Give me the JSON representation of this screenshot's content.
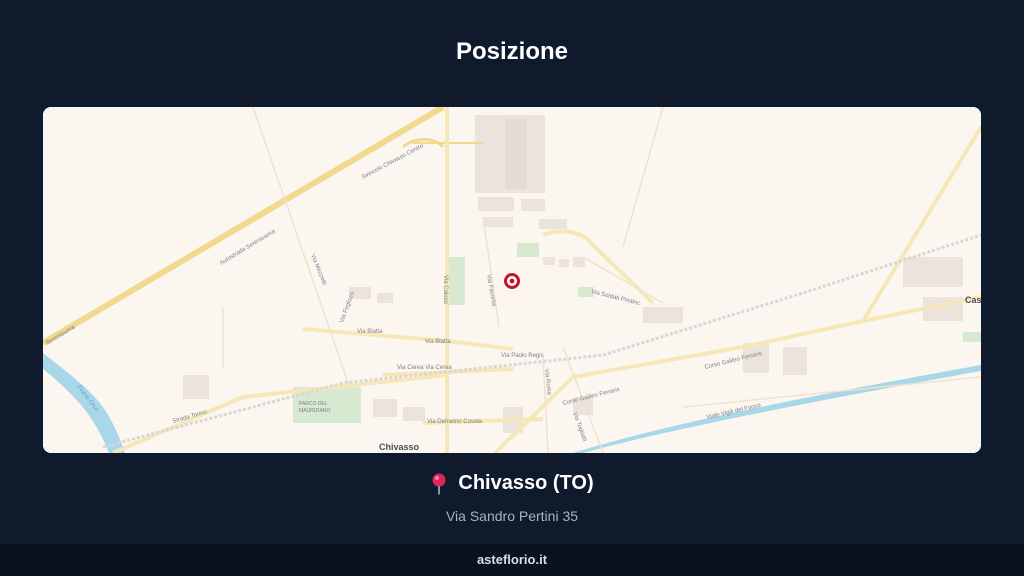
{
  "header": {
    "title": "Posizione"
  },
  "map": {
    "labels": {
      "autostrada_serenissima": "Autostrada Serenissima",
      "serenissima": "Serenissima",
      "svincolo": "Svincolo Chivasso Centro",
      "via_mezzetti": "Via Mezzetti",
      "via_caluso": "Via Caluso",
      "via_favorita": "Via Favorita",
      "via_soldati_pristinc": "Via Soldati Pristinc",
      "via_blatta": "Via Blatta",
      "via_blatta_2": "Via Blatta",
      "via_cerea": "Via Cerea Via Cerea",
      "via_paolo_regis": "Via Paolo Regis",
      "via_roma": "Via Roma",
      "via_foglizzo": "Via Foglizzo",
      "parco": "PARCO DEL",
      "parco2": "MAURIZIANO",
      "strada_torino": "Strada Torino",
      "via_demetrio": "Via Demetrio Cosola",
      "corso_galileo_1": "Corso Galileo Ferraris",
      "corso_galileo_2": "Corso Galileo Ferraris",
      "viale_vigili": "Viale Vigili del Fuoco",
      "via_togliatti": "Via Togliatti",
      "fiume_orco": "Fiume Orco",
      "chivasso": "Chivasso",
      "cast": "Cast"
    },
    "colors": {
      "background": "#fcf6f1",
      "highway": "#f1d98e",
      "road": "#f6e8b6",
      "water": "#a9d7ea",
      "green": "#d7ead1",
      "building": "#ece3dd",
      "marker": "#c0182a"
    },
    "marker_icon": "location-marker-icon"
  },
  "location": {
    "icon": "pushpin-icon",
    "city": "Chivasso (TO)",
    "address": "Via Sandro Pertini 35"
  },
  "footer": {
    "site": "asteflorio.it"
  }
}
